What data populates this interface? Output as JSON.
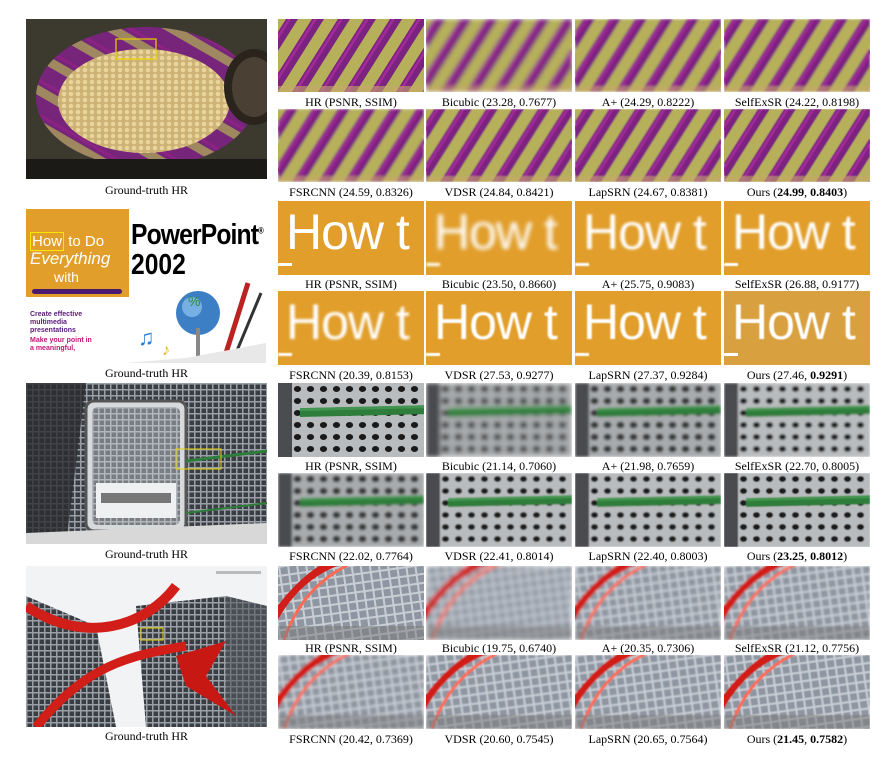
{
  "figure": {
    "rows": [
      {
        "id": "basket",
        "gt_caption": "Ground-truth HR",
        "crops": [
          {
            "method": "HR",
            "metrics": "(PSNR, SSIM)"
          },
          {
            "method": "Bicubic",
            "psnr": "23.28",
            "ssim": "0.7677"
          },
          {
            "method": "A+",
            "psnr": "24.29",
            "ssim": "0.8222"
          },
          {
            "method": "SelfExSR",
            "psnr": "24.22",
            "ssim": "0.8198"
          },
          {
            "method": "FSRCNN",
            "psnr": "24.59",
            "ssim": "0.8326"
          },
          {
            "method": "VDSR",
            "psnr": "24.84",
            "ssim": "0.8421"
          },
          {
            "method": "LapSRN",
            "psnr": "24.67",
            "ssim": "0.8381"
          },
          {
            "method": "Ours",
            "psnr": "24.99",
            "ssim": "0.8403",
            "bold_psnr": true,
            "bold_ssim": true
          }
        ]
      },
      {
        "id": "book",
        "gt_caption": "Ground-truth HR",
        "book": {
          "how": "How",
          "to_do": "to Do",
          "everything": "Everything",
          "with": "with",
          "product": "PowerPoint",
          "year": "2002",
          "reg": "®",
          "blurb1": "Create effective",
          "blurb2": "multimedia",
          "blurb3": "presentations",
          "blurb4": "Make your point in",
          "blurb5": "a meaningful,"
        },
        "crop_text": "How t",
        "crops": [
          {
            "method": "HR",
            "metrics": "(PSNR, SSIM)"
          },
          {
            "method": "Bicubic",
            "psnr": "23.50",
            "ssim": "0.8660"
          },
          {
            "method": "A+",
            "psnr": "25.75",
            "ssim": "0.9083"
          },
          {
            "method": "SelfExSR",
            "psnr": "26.88",
            "ssim": "0.9177"
          },
          {
            "method": "FSRCNN",
            "psnr": "20.39",
            "ssim": "0.8153"
          },
          {
            "method": "VDSR",
            "psnr": "27.53",
            "ssim": "0.9277"
          },
          {
            "method": "LapSRN",
            "psnr": "27.37",
            "ssim": "0.9284"
          },
          {
            "method": "Ours",
            "psnr": "27.46",
            "ssim": "0.9291",
            "bold_psnr": false,
            "bold_ssim": true
          }
        ]
      },
      {
        "id": "perforated",
        "gt_caption": "Ground-truth HR",
        "crops": [
          {
            "method": "HR",
            "metrics": "(PSNR, SSIM)"
          },
          {
            "method": "Bicubic",
            "psnr": "21.14",
            "ssim": "0.7060"
          },
          {
            "method": "A+",
            "psnr": "21.98",
            "ssim": "0.7659"
          },
          {
            "method": "SelfExSR",
            "psnr": "22.70",
            "ssim": "0.8005"
          },
          {
            "method": "FSRCNN",
            "psnr": "22.02",
            "ssim": "0.7764"
          },
          {
            "method": "VDSR",
            "psnr": "22.41",
            "ssim": "0.8014"
          },
          {
            "method": "LapSRN",
            "psnr": "22.40",
            "ssim": "0.8003"
          },
          {
            "method": "Ours",
            "psnr": "23.25",
            "ssim": "0.8012",
            "bold_psnr": true,
            "bold_ssim": true
          }
        ]
      },
      {
        "id": "buildings",
        "gt_caption": "Ground-truth HR",
        "crops": [
          {
            "method": "HR",
            "metrics": "(PSNR, SSIM)"
          },
          {
            "method": "Bicubic",
            "psnr": "19.75",
            "ssim": "0.6740"
          },
          {
            "method": "A+",
            "psnr": "20.35",
            "ssim": "0.7306"
          },
          {
            "method": "SelfExSR",
            "psnr": "21.12",
            "ssim": "0.7756"
          },
          {
            "method": "FSRCNN",
            "psnr": "20.42",
            "ssim": "0.7369"
          },
          {
            "method": "VDSR",
            "psnr": "20.60",
            "ssim": "0.7545"
          },
          {
            "method": "LapSRN",
            "psnr": "20.65",
            "ssim": "0.7564"
          },
          {
            "method": "Ours",
            "psnr": "21.45",
            "ssim": "0.7582",
            "bold_psnr": true,
            "bold_ssim": true
          }
        ]
      }
    ]
  },
  "colors": {
    "purple": "#8a2b8e",
    "stripe_yellow": "#b7b25a",
    "book_orange": "#e19e2a",
    "steel": "#9c9fa3",
    "rail_green": "#2f7d3b",
    "red_sculpture": "#d21e18",
    "highlight_box": "#e6d200"
  }
}
